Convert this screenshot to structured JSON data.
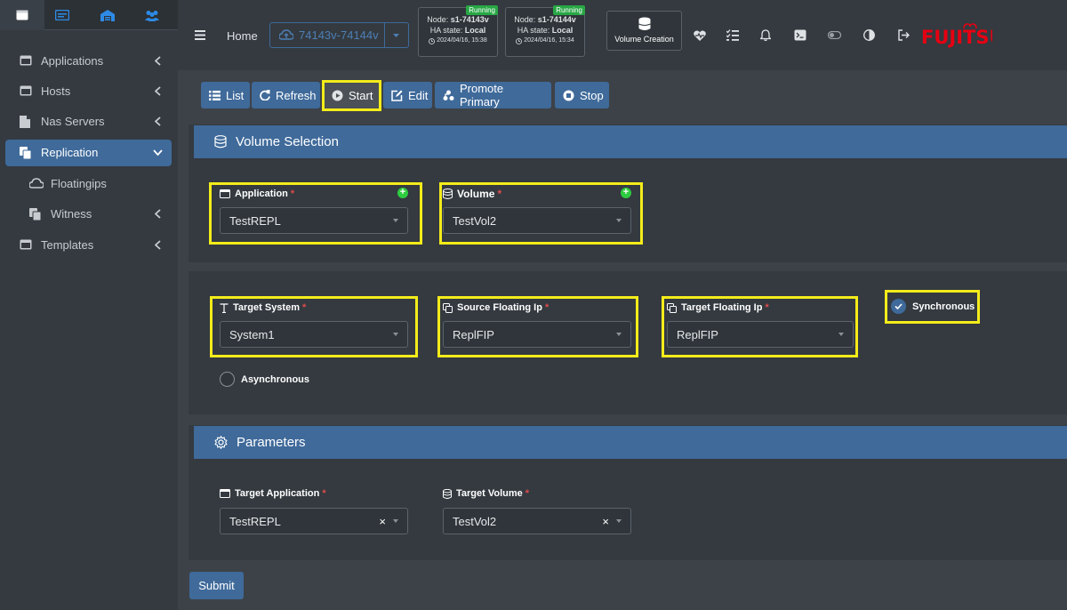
{
  "sidebar": {
    "tabs": [
      "window-tab-icon",
      "card-tab-icon",
      "warehouse-tab-icon",
      "users-tab-icon"
    ],
    "items": [
      {
        "label": "Applications",
        "icon": "window-icon",
        "chevron": "left"
      },
      {
        "label": "Hosts",
        "icon": "server-icon",
        "chevron": "left"
      },
      {
        "label": "Nas Servers",
        "icon": "file-icon",
        "chevron": "left"
      },
      {
        "label": "Replication",
        "icon": "copy-icon",
        "chevron": "down",
        "active": true
      },
      {
        "label": "Floatingips",
        "icon": "cloud-icon",
        "chevron": null,
        "sub": true
      },
      {
        "label": "Witness",
        "icon": "copy-icon",
        "chevron": "left",
        "sub": true
      },
      {
        "label": "Templates",
        "icon": "window-icon",
        "chevron": "left"
      }
    ]
  },
  "topbar": {
    "home": "Home",
    "cluster_select": "74143v-74144v",
    "nodes": [
      {
        "status": "Running",
        "node_label": "Node:",
        "node_name": "s1-74143v",
        "ha_label": "HA state:",
        "ha_state": "Local",
        "time": "2024/04/16, 15:38"
      },
      {
        "status": "Running",
        "node_label": "Node:",
        "node_name": "s1-74144v",
        "ha_label": "HA state:",
        "ha_state": "Local",
        "time": "2024/04/16, 15:34"
      }
    ],
    "volume_creation": "Volume Creation",
    "brand": "FUJITSU"
  },
  "toolbar": {
    "list": "List",
    "refresh": "Refresh",
    "start": "Start",
    "edit": "Edit",
    "promote": "Promote Primary",
    "stop": "Stop"
  },
  "volume_selection": {
    "title": "Volume Selection",
    "application_label": "Application",
    "application_value": "TestREPL",
    "volume_label": "Volume",
    "volume_value": "TestVol2"
  },
  "targets": {
    "target_system_label": "Target System",
    "target_system_value": "System1",
    "source_fip_label": "Source Floating Ip",
    "source_fip_value": "ReplFIP",
    "target_fip_label": "Target Floating Ip",
    "target_fip_value": "ReplFIP",
    "synchronous": "Synchronous",
    "asynchronous": "Asynchronous"
  },
  "parameters": {
    "title": "Parameters",
    "target_app_label": "Target Application",
    "target_app_value": "TestREPL",
    "target_vol_label": "Target Volume",
    "target_vol_value": "TestVol2"
  },
  "submit": "Submit",
  "colors": {
    "accent": "#3f6a9a",
    "highlight": "#f4ec1a",
    "required": "#e04b4b",
    "running": "#28a745",
    "brand": "#e60012"
  }
}
